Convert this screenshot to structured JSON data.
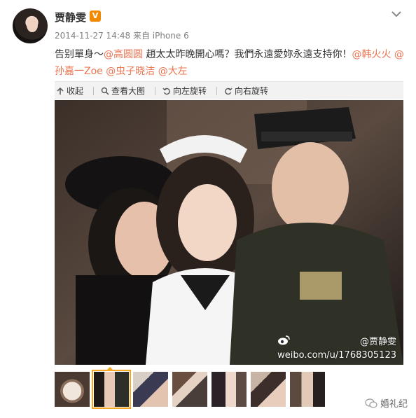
{
  "post": {
    "username": "贾静雯",
    "badge": "V",
    "timestamp": "2014-11-27 14:48",
    "source": "来自 iPhone 6",
    "text_parts": {
      "p1": "告别單身～",
      "m1": "@高圆圆",
      "p2": " 趙太太昨晚開心嗎？我們永遠愛妳永遠支持你！",
      "m2": "@韩火火",
      "m3": " @",
      "m4": "孙嘉一Zoe",
      "m5": "@虫子晓洁",
      "m6": "@大左"
    }
  },
  "actions": {
    "collapse": "收起",
    "view_large": "查看大图",
    "rotate_left": "向左旋转",
    "rotate_right": "向右旋转"
  },
  "watermark": {
    "handle": "@贾静雯",
    "url": "weibo.com/u/1768305123"
  },
  "corner_logo": "婚礼纪",
  "colors": {
    "mention": "#eb7350",
    "selected_border": "#f5a623",
    "vbadge": "#f28a00"
  },
  "icons": [
    "chevron-down-icon",
    "collapse-icon",
    "magnify-icon",
    "rotate-left-icon",
    "rotate-right-icon",
    "weibo-logo-icon",
    "wechat-icon"
  ]
}
